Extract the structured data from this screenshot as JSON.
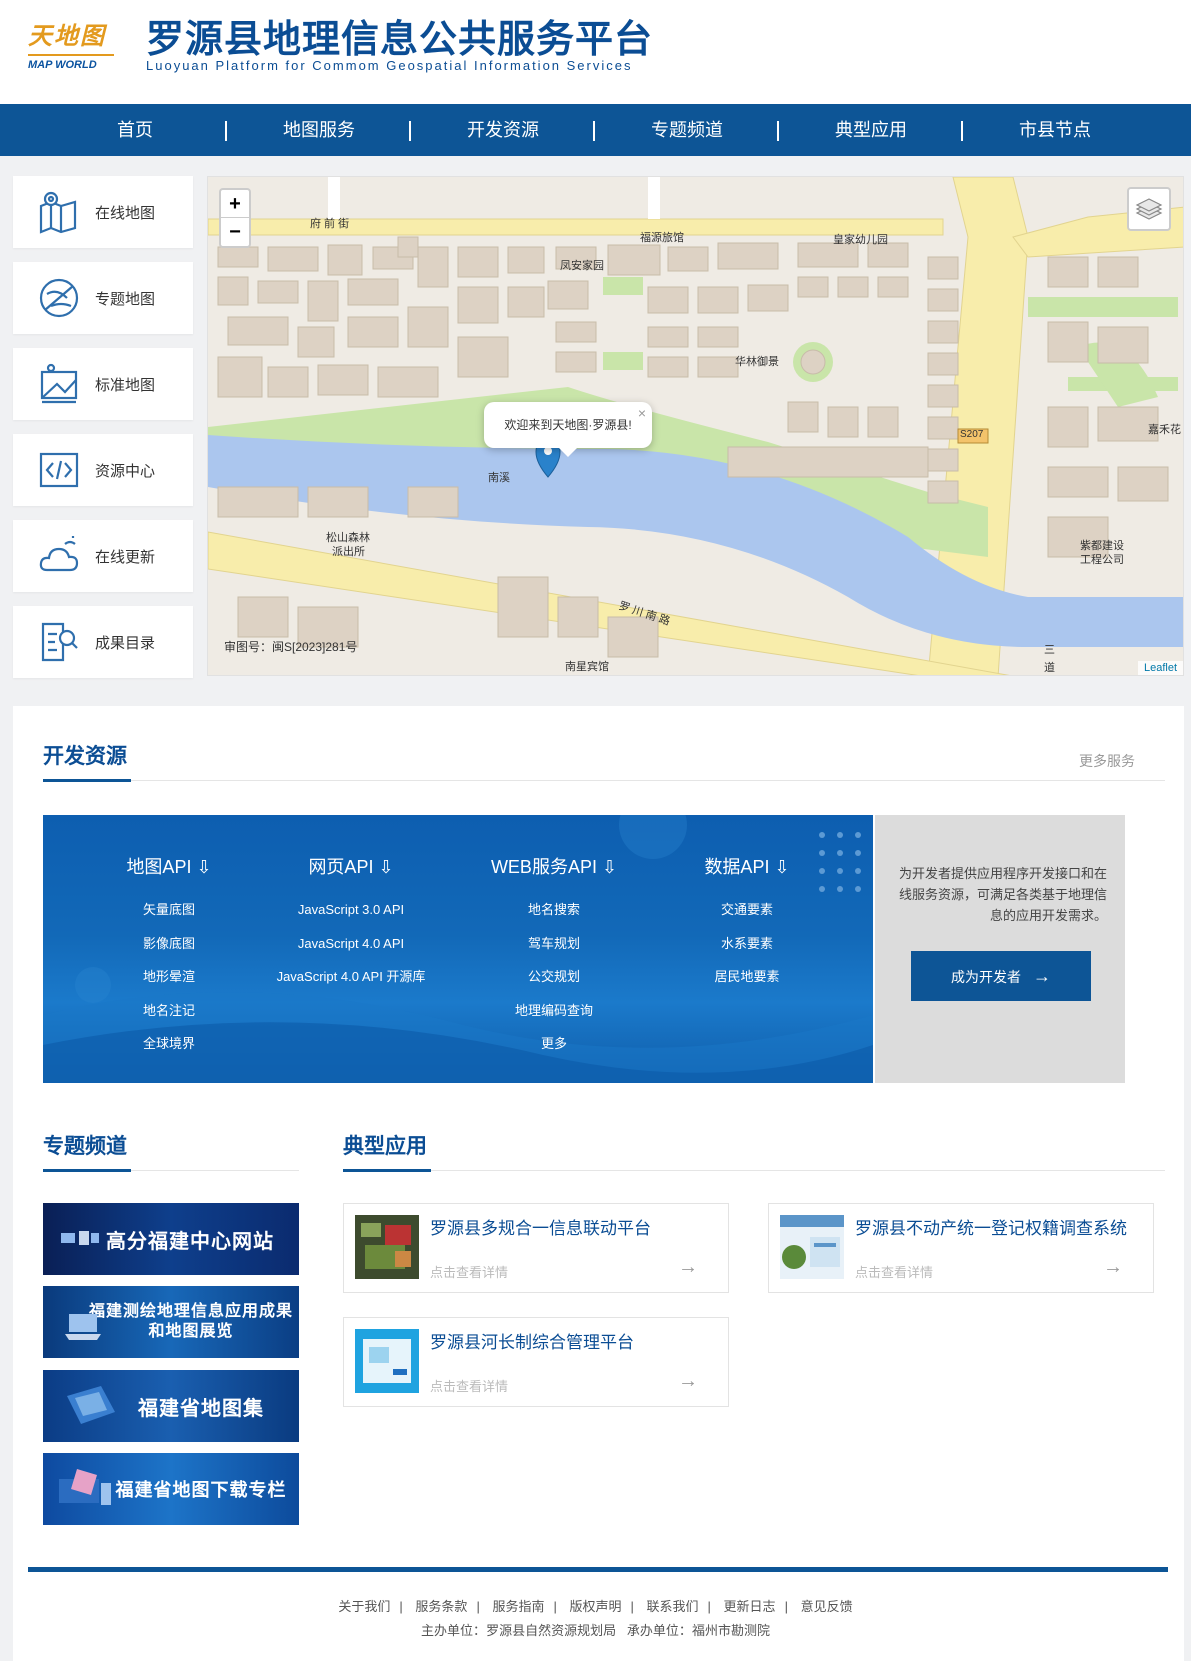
{
  "header": {
    "logo_cn": "天地图",
    "logo_en": "MAP WORLD",
    "title": "罗源县地理信息公共服务平台",
    "subtitle": "Luoyuan Platform for  Commom Geospatial Information Services"
  },
  "nav": {
    "items": [
      {
        "label": "首页"
      },
      {
        "label": "地图服务"
      },
      {
        "label": "开发资源"
      },
      {
        "label": "专题频道"
      },
      {
        "label": "典型应用"
      },
      {
        "label": "市县节点"
      }
    ]
  },
  "left_tiles": [
    {
      "label": "在线地图",
      "icon": "map-pin-icon"
    },
    {
      "label": "专题地图",
      "icon": "globe-slash-icon"
    },
    {
      "label": "标准地图",
      "icon": "framed-map-icon"
    },
    {
      "label": "资源中心",
      "icon": "code-icon"
    },
    {
      "label": "在线更新",
      "icon": "cloud-sun-icon"
    },
    {
      "label": "成果目录",
      "icon": "document-search-icon"
    }
  ],
  "map": {
    "zoom_in": "+",
    "zoom_out": "−",
    "popup_text": "欢迎来到天地图·罗源县!",
    "popup_close": "×",
    "approval": "审图号：闽S[2023]281号",
    "attribution": "Leaflet",
    "labels": {
      "fuqian": "府 前 街",
      "fuyuan": "福源旅馆",
      "huangjia": "皇家幼儿园",
      "fengan": "凤安家园",
      "hualin": "华林御景",
      "nanxi": "南溪",
      "songshan1": "松山森林",
      "songshan2": "派出所",
      "luochuan": "罗 川 南 路",
      "nanxing": "南星宾馆",
      "s207": "S207",
      "jiahe": "嘉禾花",
      "zidu1": "紫都建设",
      "zidu2": "工程公司",
      "sandao1": "三",
      "sandao2": "道"
    }
  },
  "dev": {
    "heading": "开发资源",
    "more": "更多服务",
    "columns": [
      {
        "title": "地图API",
        "items": [
          "矢量底图",
          "影像底图",
          "地形晕渲",
          "地名注记",
          "全球境界"
        ]
      },
      {
        "title": "网页API",
        "items": [
          "JavaScript 3.0 API",
          "JavaScript 4.0 API",
          "JavaScript 4.0 API 开源库"
        ]
      },
      {
        "title": "WEB服务API",
        "items": [
          "地名搜索",
          "驾车规划",
          "公交规划",
          "地理编码查询",
          "更多"
        ]
      },
      {
        "title": "数据API",
        "items": [
          "交通要素",
          "水系要素",
          "居民地要素"
        ]
      }
    ],
    "desc": "为开发者提供应用程序开发接口和在线服务资源，可满足各类基于地理信息的应用开发需求。",
    "button": "成为开发者"
  },
  "topics": {
    "heading": "专题频道",
    "banners": [
      {
        "label": "高分福建中心网站"
      },
      {
        "label": "福建测绘地理信息应用成果和地图展览"
      },
      {
        "label": "福建省地图集"
      },
      {
        "label": "福建省地图下载专栏"
      }
    ]
  },
  "apps": {
    "heading": "典型应用",
    "items": [
      {
        "title": "罗源县多规合一信息联动平台",
        "detail": "点击查看详情"
      },
      {
        "title": "罗源县不动产统一登记权籍调查系统",
        "detail": "点击查看详情"
      },
      {
        "title": "罗源县河长制综合管理平台",
        "detail": "点击查看详情"
      }
    ]
  },
  "footer": {
    "links": [
      "关于我们",
      "服务条款",
      "服务指南",
      "版权声明",
      "联系我们",
      "更新日志",
      "意见反馈"
    ],
    "org_label1": "主办单位：",
    "org1": "罗源县自然资源规划局",
    "org_label2": "承办单位：",
    "org2": "福州市勘测院"
  },
  "colors": {
    "brand": "#0d5596",
    "title_blue": "#0b4d94",
    "logo_orange": "#e39a1e"
  }
}
